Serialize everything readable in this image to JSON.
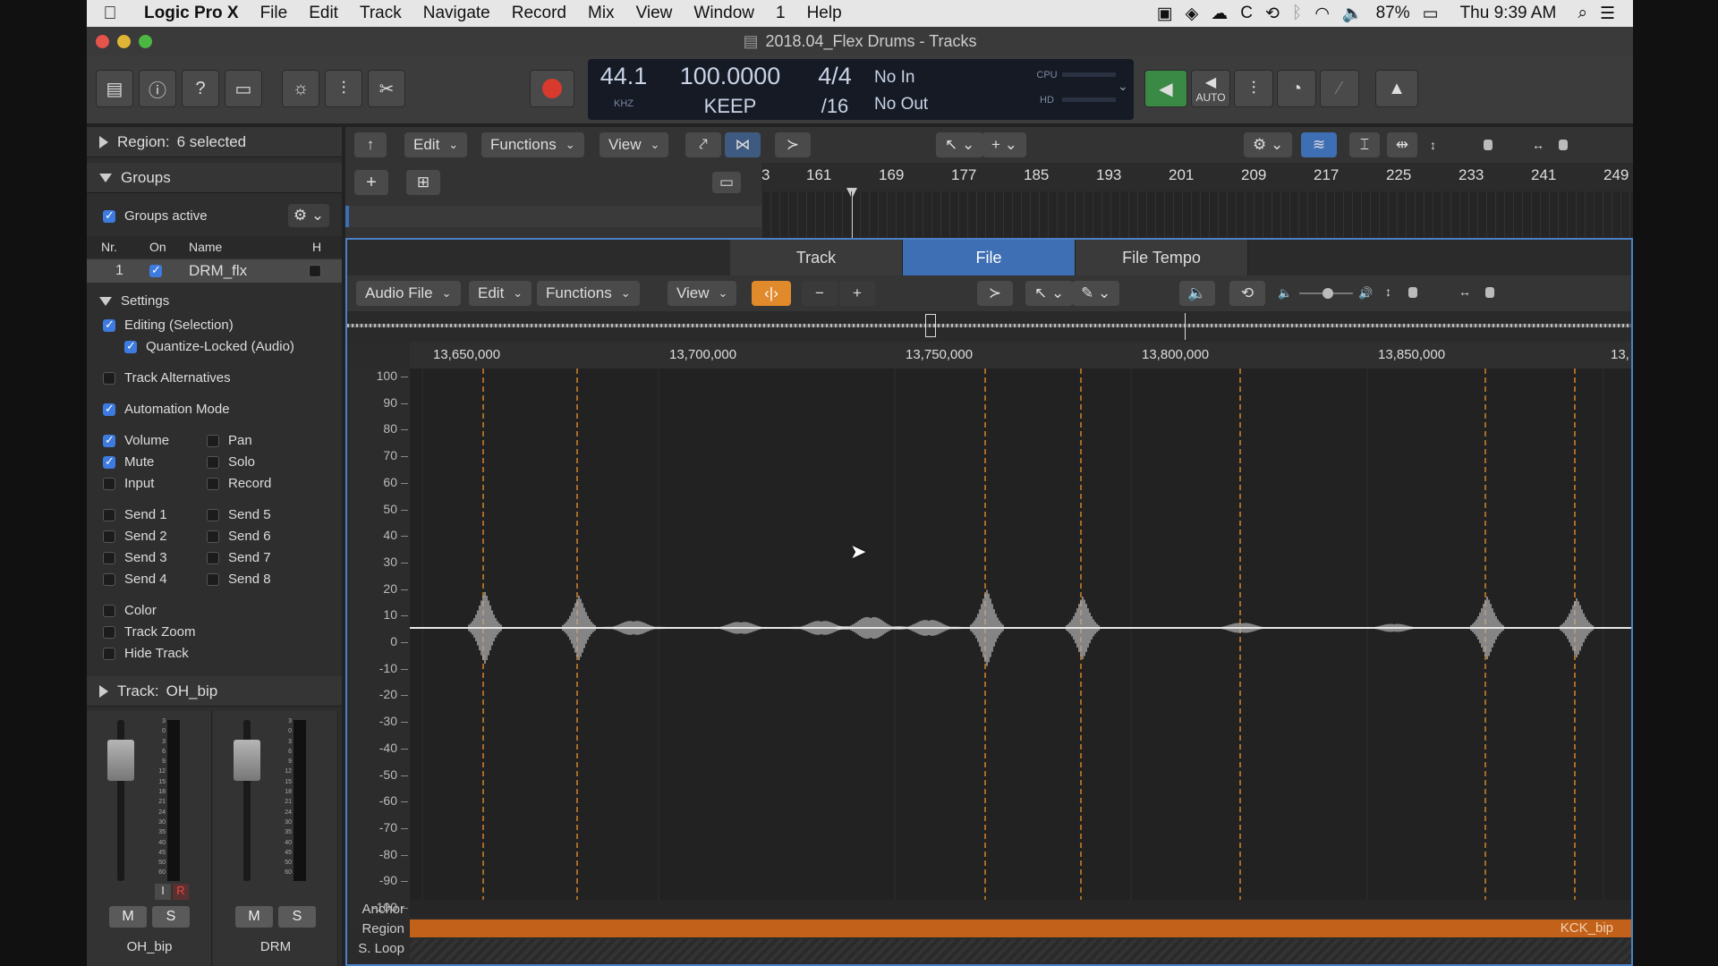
{
  "menubar": {
    "items": [
      "Logic Pro X",
      "File",
      "Edit",
      "Track",
      "Navigate",
      "Record",
      "Mix",
      "View",
      "Window",
      "1",
      "Help"
    ],
    "battery": "87%",
    "clock": "Thu 9:39 AM"
  },
  "window": {
    "title": "2018.04_Flex Drums - Tracks"
  },
  "lcd": {
    "sample_rate": "44.1",
    "sample_rate_unit": "KHZ",
    "tempo": "100.0000",
    "tempo_mode": "KEEP",
    "signature_top": "4/4",
    "signature_bottom": "/16",
    "in": "No In",
    "out": "No Out",
    "cpu_label": "CPU",
    "hd_label": "HD"
  },
  "controlbar": {
    "auto_label": "AUTO"
  },
  "inspector": {
    "region_label": "Region:",
    "region_value": "6 selected",
    "groups_title": "Groups",
    "groups_active": "Groups active",
    "table_headers": [
      "Nr.",
      "On",
      "Name",
      "H"
    ],
    "group_row": {
      "nr": "1",
      "name": "DRM_flx"
    },
    "settings_title": "Settings",
    "settings": {
      "editing": "Editing (Selection)",
      "quantize": "Quantize-Locked (Audio)",
      "track_alt": "Track Alternatives",
      "automation": "Automation Mode",
      "volume": "Volume",
      "pan": "Pan",
      "mute": "Mute",
      "solo": "Solo",
      "input": "Input",
      "record": "Record",
      "send1": "Send 1",
      "send5": "Send 5",
      "send2": "Send 2",
      "send6": "Send 6",
      "send3": "Send 3",
      "send7": "Send 7",
      "send4": "Send 4",
      "send8": "Send 8",
      "color": "Color",
      "track_zoom": "Track Zoom",
      "hide_track": "Hide Track"
    },
    "track_label": "Track:",
    "track_value": "OH_bip"
  },
  "strips": [
    {
      "name": "OH_bip",
      "m": "M",
      "s": "S",
      "i": "I",
      "r": "R"
    },
    {
      "name": "DRM",
      "m": "M",
      "s": "S"
    }
  ],
  "meter_scale": [
    "3",
    "0",
    "3",
    "6",
    "9",
    "12",
    "15",
    "18",
    "21",
    "24",
    "30",
    "35",
    "40",
    "45",
    "50",
    "60"
  ],
  "tracks_toolbar": {
    "edit": "Edit",
    "functions": "Functions",
    "view": "View"
  },
  "bar_ruler": [
    "161",
    "169",
    "177",
    "185",
    "193",
    "201",
    "209",
    "217",
    "225",
    "233",
    "241",
    "249"
  ],
  "bar_ruler_edge": "3",
  "editor": {
    "tabs": [
      "Track",
      "File",
      "File Tempo"
    ],
    "toolbar": {
      "audio_file": "Audio File",
      "edit": "Edit",
      "functions": "Functions",
      "view": "View"
    },
    "sample_ruler": [
      "13,650,000",
      "13,700,000",
      "13,750,000",
      "13,800,000",
      "13,850,000"
    ],
    "sample_ruler_edge": "13,",
    "y_scale": [
      "100",
      "90",
      "80",
      "70",
      "60",
      "50",
      "40",
      "30",
      "20",
      "10",
      "0",
      "-10",
      "-20",
      "-30",
      "-40",
      "-50",
      "-60",
      "-70",
      "-80",
      "-90",
      "-100"
    ],
    "lanes": [
      "Anchor",
      "Region",
      "S. Loop"
    ],
    "region_name": "KCK_bip"
  },
  "colors": {
    "accent_blue": "#3e6eb4",
    "transient_orange": "#e08a2c",
    "region_orange": "#c2621a",
    "record_red": "#d83a2e",
    "power_green": "#3a8a45"
  }
}
